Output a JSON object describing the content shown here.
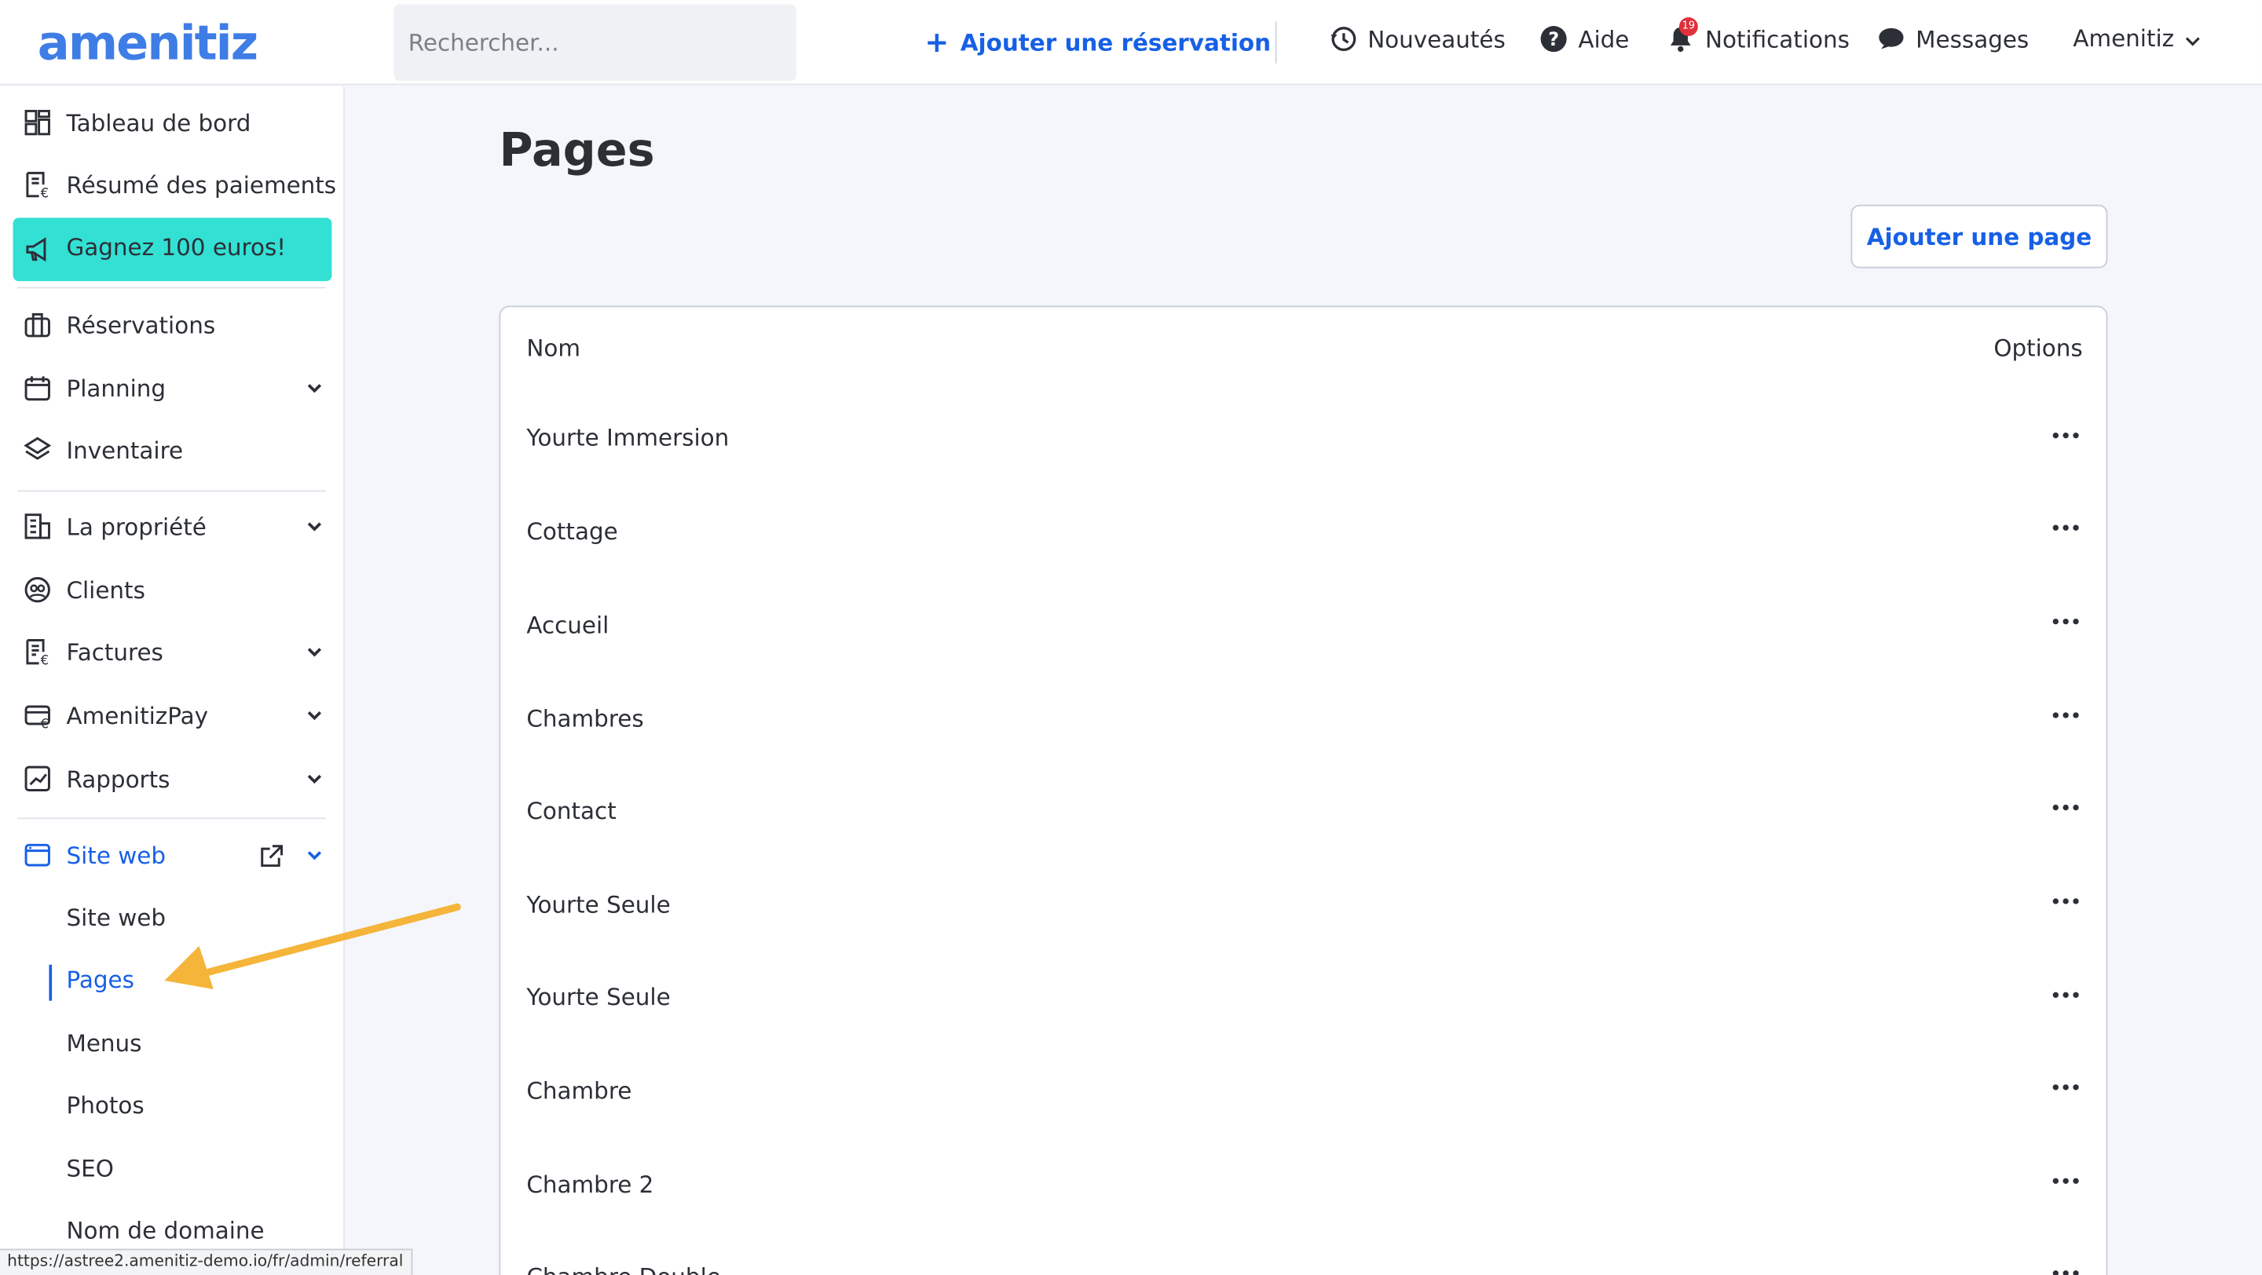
{
  "brand": {
    "logo": "amenitiz"
  },
  "header": {
    "search_placeholder": "Rechercher...",
    "add_reservation": "Ajouter une réservation",
    "news": "Nouveautés",
    "help": "Aide",
    "notifications": "Notifications",
    "notifications_count": "19",
    "messages": "Messages",
    "account": "Amenitiz"
  },
  "sidebar": {
    "dashboard": "Tableau de bord",
    "payments": "Résumé des paiements",
    "promo": "Gagnez 100 euros!",
    "reservations": "Réservations",
    "planning": "Planning",
    "inventory": "Inventaire",
    "property": "La propriété",
    "clients": "Clients",
    "invoices": "Factures",
    "amenitizpay": "AmenitizPay",
    "reports": "Rapports",
    "website": "Site web",
    "sub": [
      "Site web",
      "Pages",
      "Menus",
      "Photos",
      "SEO",
      "Nom de domaine"
    ]
  },
  "main": {
    "title": "Pages",
    "add_page": "Ajouter une page",
    "col_name": "Nom",
    "col_options": "Options",
    "rows": [
      "Yourte Immersion",
      "Cottage",
      "Accueil",
      "Chambres",
      "Contact",
      "Yourte Seule",
      "Yourte Seule",
      "Chambre",
      "Chambre 2",
      "Chambre Double"
    ]
  },
  "status_url": "https://astree2.amenitiz-demo.io/fr/admin/referral",
  "colors": {
    "accent": "#1760e5",
    "promo": "#33e0d4",
    "annotation_arrow": "#f5b43a"
  }
}
